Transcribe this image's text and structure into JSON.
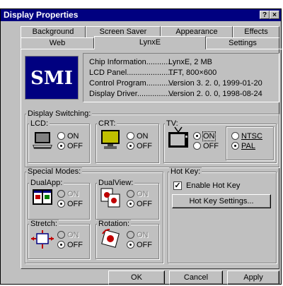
{
  "window": {
    "title": "Display Properties",
    "help_btn": "?",
    "close_btn": "×"
  },
  "tabs_back": [
    "Background",
    "Screen Saver",
    "Appearance",
    "Effects"
  ],
  "tabs_front": [
    "Web",
    "LynxE",
    "Settings"
  ],
  "logo_text": "SMI",
  "info": [
    {
      "key": "Chip Information............",
      "value": "LynxE, 2 MB"
    },
    {
      "key": "LCD Panel......................",
      "value": "TFT, 800×600"
    },
    {
      "key": "Control Program..............",
      "value": "Version 3. 2. 0, 1999-01-20"
    },
    {
      "key": "Display Driver.................",
      "value": "Version 2. 0. 0, 1998-08-24"
    }
  ],
  "display_switching": {
    "label": "Display Switching:",
    "lcd": {
      "label": "LCD:",
      "on": "ON",
      "off": "OFF",
      "selected": "OFF"
    },
    "crt": {
      "label": "CRT:",
      "on": "ON",
      "off": "OFF",
      "selected": "OFF"
    },
    "tv": {
      "label": "TV:",
      "on": "ON",
      "off": "OFF",
      "selected": "ON",
      "ntsc": "NTSC",
      "pal": "PAL",
      "standard": "PAL"
    }
  },
  "special_modes": {
    "label": "Special Modes:",
    "dualapp": {
      "label": "DualApp:",
      "on": "ON",
      "off": "OFF"
    },
    "dualview": {
      "label": "DualView:",
      "on": "ON",
      "off": "OFF"
    },
    "stretch": {
      "label": "Stretch:",
      "on": "ON",
      "off": "OFF"
    },
    "rotation": {
      "label": "Rotation:",
      "on": "ON",
      "off": "OFF"
    }
  },
  "hotkey": {
    "label": "Hot Key:",
    "enable_label": "Enable Hot Key",
    "enabled": true,
    "settings_btn": "Hot Key Settings..."
  },
  "buttons": {
    "ok": "OK",
    "cancel": "Cancel",
    "apply": "Apply"
  }
}
